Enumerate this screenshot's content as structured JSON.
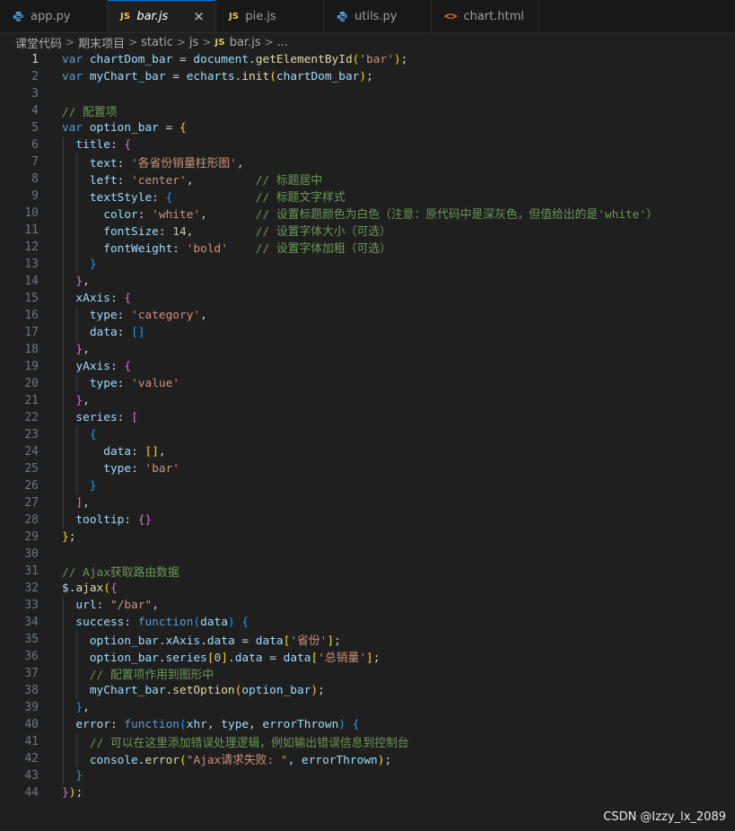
{
  "tabs": [
    {
      "label": "app.py",
      "icon": "python-icon",
      "active": false,
      "italic": false
    },
    {
      "label": "bar.js",
      "icon": "javascript-icon",
      "active": true,
      "italic": true
    },
    {
      "label": "pie.js",
      "icon": "javascript-icon",
      "active": false,
      "italic": false
    },
    {
      "label": "utils.py",
      "icon": "python-icon",
      "active": false,
      "italic": false
    },
    {
      "label": "chart.html",
      "icon": "html-icon",
      "active": false,
      "italic": false
    }
  ],
  "icon_glyphs": {
    "js": "JS",
    "html": "<>",
    "close": "×",
    "chevron": ">"
  },
  "breadcrumb": [
    "课堂代码",
    "期末项目",
    "static",
    "js",
    "bar.js",
    "..."
  ],
  "code_lines": [
    [
      [
        "kw",
        "var"
      ],
      [
        "pn",
        " "
      ],
      [
        "var",
        "chartDom_bar"
      ],
      [
        "pn",
        " = "
      ],
      [
        "var",
        "document"
      ],
      [
        "pn",
        "."
      ],
      [
        "fn",
        "getElementById"
      ],
      [
        "br1",
        "("
      ],
      [
        "str",
        "'bar'"
      ],
      [
        "br1",
        ")"
      ],
      [
        "pn",
        ";"
      ]
    ],
    [
      [
        "kw",
        "var"
      ],
      [
        "pn",
        " "
      ],
      [
        "var",
        "myChart_bar"
      ],
      [
        "pn",
        " = "
      ],
      [
        "var",
        "echarts"
      ],
      [
        "pn",
        "."
      ],
      [
        "fn",
        "init"
      ],
      [
        "br1",
        "("
      ],
      [
        "var",
        "chartDom_bar"
      ],
      [
        "br1",
        ")"
      ],
      [
        "pn",
        ";"
      ]
    ],
    [],
    [
      [
        "cm",
        "// 配置项"
      ]
    ],
    [
      [
        "kw",
        "var"
      ],
      [
        "pn",
        " "
      ],
      [
        "var",
        "option_bar"
      ],
      [
        "pn",
        " = "
      ],
      [
        "br1",
        "{"
      ]
    ],
    [
      [
        "pn",
        "  "
      ],
      [
        "var",
        "title"
      ],
      [
        "pn",
        ": "
      ],
      [
        "br2",
        "{"
      ]
    ],
    [
      [
        "pn",
        "    "
      ],
      [
        "var",
        "text"
      ],
      [
        "pn",
        ": "
      ],
      [
        "str",
        "'各省份销量柱形图'"
      ],
      [
        "pn",
        ","
      ]
    ],
    [
      [
        "pn",
        "    "
      ],
      [
        "var",
        "left"
      ],
      [
        "pn",
        ": "
      ],
      [
        "str",
        "'center'"
      ],
      [
        "pn",
        ",         "
      ],
      [
        "cm",
        "// 标题居中"
      ]
    ],
    [
      [
        "pn",
        "    "
      ],
      [
        "var",
        "textStyle"
      ],
      [
        "pn",
        ": "
      ],
      [
        "br3",
        "{"
      ],
      [
        "pn",
        "            "
      ],
      [
        "cm",
        "// 标题文字样式"
      ]
    ],
    [
      [
        "pn",
        "      "
      ],
      [
        "var",
        "color"
      ],
      [
        "pn",
        ": "
      ],
      [
        "str",
        "'white'"
      ],
      [
        "pn",
        ",       "
      ],
      [
        "cm",
        "// 设置标题颜色为白色（注意：原代码中是深灰色，但值给出的是'white'）"
      ]
    ],
    [
      [
        "pn",
        "      "
      ],
      [
        "var",
        "fontSize"
      ],
      [
        "pn",
        ": "
      ],
      [
        "num",
        "14"
      ],
      [
        "pn",
        ",         "
      ],
      [
        "cm",
        "// 设置字体大小（可选）"
      ]
    ],
    [
      [
        "pn",
        "      "
      ],
      [
        "var",
        "fontWeight"
      ],
      [
        "pn",
        ": "
      ],
      [
        "str",
        "'bold'"
      ],
      [
        "pn",
        "    "
      ],
      [
        "cm",
        "// 设置字体加粗（可选）"
      ]
    ],
    [
      [
        "pn",
        "    "
      ],
      [
        "br3",
        "}"
      ]
    ],
    [
      [
        "pn",
        "  "
      ],
      [
        "br2",
        "}"
      ],
      [
        "pn",
        ","
      ]
    ],
    [
      [
        "pn",
        "  "
      ],
      [
        "var",
        "xAxis"
      ],
      [
        "pn",
        ": "
      ],
      [
        "br2",
        "{"
      ]
    ],
    [
      [
        "pn",
        "    "
      ],
      [
        "var",
        "type"
      ],
      [
        "pn",
        ": "
      ],
      [
        "str",
        "'category'"
      ],
      [
        "pn",
        ","
      ]
    ],
    [
      [
        "pn",
        "    "
      ],
      [
        "var",
        "data"
      ],
      [
        "pn",
        ": "
      ],
      [
        "br3",
        "[]"
      ]
    ],
    [
      [
        "pn",
        "  "
      ],
      [
        "br2",
        "}"
      ],
      [
        "pn",
        ","
      ]
    ],
    [
      [
        "pn",
        "  "
      ],
      [
        "var",
        "yAxis"
      ],
      [
        "pn",
        ": "
      ],
      [
        "br2",
        "{"
      ]
    ],
    [
      [
        "pn",
        "    "
      ],
      [
        "var",
        "type"
      ],
      [
        "pn",
        ": "
      ],
      [
        "str",
        "'value'"
      ]
    ],
    [
      [
        "pn",
        "  "
      ],
      [
        "br2",
        "}"
      ],
      [
        "pn",
        ","
      ]
    ],
    [
      [
        "pn",
        "  "
      ],
      [
        "var",
        "series"
      ],
      [
        "pn",
        ": "
      ],
      [
        "br2",
        "["
      ]
    ],
    [
      [
        "pn",
        "    "
      ],
      [
        "br3",
        "{"
      ]
    ],
    [
      [
        "pn",
        "      "
      ],
      [
        "var",
        "data"
      ],
      [
        "pn",
        ": "
      ],
      [
        "br1",
        "[]"
      ],
      [
        "pn",
        ","
      ]
    ],
    [
      [
        "pn",
        "      "
      ],
      [
        "var",
        "type"
      ],
      [
        "pn",
        ": "
      ],
      [
        "str",
        "'bar'"
      ]
    ],
    [
      [
        "pn",
        "    "
      ],
      [
        "br3",
        "}"
      ]
    ],
    [
      [
        "pn",
        "  "
      ],
      [
        "br2",
        "]"
      ],
      [
        "pn",
        ","
      ]
    ],
    [
      [
        "pn",
        "  "
      ],
      [
        "var",
        "tooltip"
      ],
      [
        "pn",
        ": "
      ],
      [
        "br2",
        "{}"
      ]
    ],
    [
      [
        "br1",
        "}"
      ],
      [
        "pn",
        ";"
      ]
    ],
    [],
    [
      [
        "cm",
        "// Ajax获取路由数据"
      ]
    ],
    [
      [
        "var",
        "$"
      ],
      [
        "pn",
        "."
      ],
      [
        "fn",
        "ajax"
      ],
      [
        "br1",
        "("
      ],
      [
        "br2",
        "{"
      ]
    ],
    [
      [
        "pn",
        "  "
      ],
      [
        "var",
        "url"
      ],
      [
        "pn",
        ": "
      ],
      [
        "str",
        "\"/bar\""
      ],
      [
        "pn",
        ","
      ]
    ],
    [
      [
        "pn",
        "  "
      ],
      [
        "var",
        "success"
      ],
      [
        "pn",
        ": "
      ],
      [
        "kw",
        "function"
      ],
      [
        "br3",
        "("
      ],
      [
        "var",
        "data"
      ],
      [
        "br3",
        ")"
      ],
      [
        "pn",
        " "
      ],
      [
        "br3",
        "{"
      ]
    ],
    [
      [
        "pn",
        "    "
      ],
      [
        "var",
        "option_bar"
      ],
      [
        "pn",
        "."
      ],
      [
        "var",
        "xAxis"
      ],
      [
        "pn",
        "."
      ],
      [
        "var",
        "data"
      ],
      [
        "pn",
        " = "
      ],
      [
        "var",
        "data"
      ],
      [
        "br1",
        "["
      ],
      [
        "str",
        "'省份'"
      ],
      [
        "br1",
        "]"
      ],
      [
        "pn",
        ";"
      ]
    ],
    [
      [
        "pn",
        "    "
      ],
      [
        "var",
        "option_bar"
      ],
      [
        "pn",
        "."
      ],
      [
        "var",
        "series"
      ],
      [
        "br1",
        "["
      ],
      [
        "num",
        "0"
      ],
      [
        "br1",
        "]"
      ],
      [
        "pn",
        "."
      ],
      [
        "var",
        "data"
      ],
      [
        "pn",
        " = "
      ],
      [
        "var",
        "data"
      ],
      [
        "br1",
        "["
      ],
      [
        "str",
        "'总销量'"
      ],
      [
        "br1",
        "]"
      ],
      [
        "pn",
        ";"
      ]
    ],
    [
      [
        "pn",
        "    "
      ],
      [
        "cm",
        "// 配置项作用到图形中"
      ]
    ],
    [
      [
        "pn",
        "    "
      ],
      [
        "var",
        "myChart_bar"
      ],
      [
        "pn",
        "."
      ],
      [
        "fn",
        "setOption"
      ],
      [
        "br1",
        "("
      ],
      [
        "var",
        "option_bar"
      ],
      [
        "br1",
        ")"
      ],
      [
        "pn",
        ";"
      ]
    ],
    [
      [
        "pn",
        "  "
      ],
      [
        "br3",
        "}"
      ],
      [
        "pn",
        ","
      ]
    ],
    [
      [
        "pn",
        "  "
      ],
      [
        "var",
        "error"
      ],
      [
        "pn",
        ": "
      ],
      [
        "kw",
        "function"
      ],
      [
        "br3",
        "("
      ],
      [
        "var",
        "xhr"
      ],
      [
        "pn",
        ", "
      ],
      [
        "var",
        "type"
      ],
      [
        "pn",
        ", "
      ],
      [
        "var",
        "errorThrown"
      ],
      [
        "br3",
        ")"
      ],
      [
        "pn",
        " "
      ],
      [
        "br3",
        "{"
      ]
    ],
    [
      [
        "pn",
        "    "
      ],
      [
        "cm",
        "// 可以在这里添加错误处理逻辑，例如输出错误信息到控制台"
      ]
    ],
    [
      [
        "pn",
        "    "
      ],
      [
        "var",
        "console"
      ],
      [
        "pn",
        "."
      ],
      [
        "fn",
        "error"
      ],
      [
        "br1",
        "("
      ],
      [
        "str",
        "\"Ajax请求失败: \""
      ],
      [
        "pn",
        ", "
      ],
      [
        "var",
        "errorThrown"
      ],
      [
        "br1",
        ")"
      ],
      [
        "pn",
        ";"
      ]
    ],
    [
      [
        "pn",
        "  "
      ],
      [
        "br3",
        "}"
      ]
    ],
    [
      [
        "br2",
        "}"
      ],
      [
        "br1",
        ")"
      ],
      [
        "pn",
        ";"
      ]
    ]
  ],
  "current_line": 1,
  "colors": {
    "background": "#1f1f1f",
    "tab_active_border": "#0078d4",
    "python_icon": "#4d9bd6",
    "js_icon": "#e8c84a",
    "html_icon": "#e37933"
  },
  "watermark": "CSDN @Izzy_lx_2089"
}
